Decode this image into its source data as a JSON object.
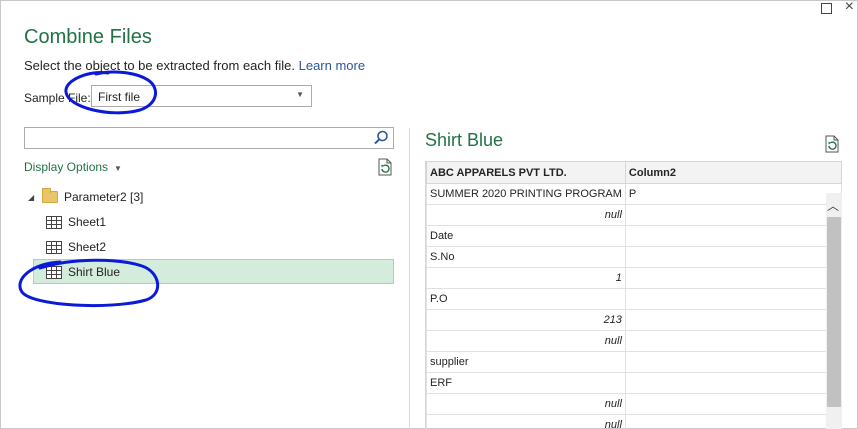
{
  "window": {
    "title": "Combine Files"
  },
  "description": {
    "text": "Select the object to be extracted from each file.",
    "link": "Learn more"
  },
  "sample_file": {
    "label": "Sample File:",
    "value": "First file"
  },
  "search": {
    "placeholder": ""
  },
  "display_options": {
    "label": "Display Options"
  },
  "tree": {
    "folder": "Parameter2 [3]",
    "items": [
      "Sheet1",
      "Sheet2",
      "Shirt Blue"
    ]
  },
  "preview": {
    "title": "Shirt Blue",
    "columns": [
      "ABC APPARELS PVT LTD.",
      "Column2"
    ],
    "rows": [
      [
        "SUMMER 2020 PRINTING PROGRAM",
        "P"
      ],
      [
        "null",
        ""
      ],
      [
        "Date",
        ""
      ],
      [
        "S.No",
        ""
      ],
      [
        "1",
        ""
      ],
      [
        "P.O",
        ""
      ],
      [
        "213",
        ""
      ],
      [
        "null",
        ""
      ],
      [
        "supplier",
        ""
      ],
      [
        "ERF",
        ""
      ],
      [
        "null",
        ""
      ],
      [
        "null",
        ""
      ]
    ]
  },
  "colors": {
    "accent": "#217346",
    "link": "#2b579a",
    "selection": "#d3ecdc",
    "annotation": "#0a1ad8"
  }
}
